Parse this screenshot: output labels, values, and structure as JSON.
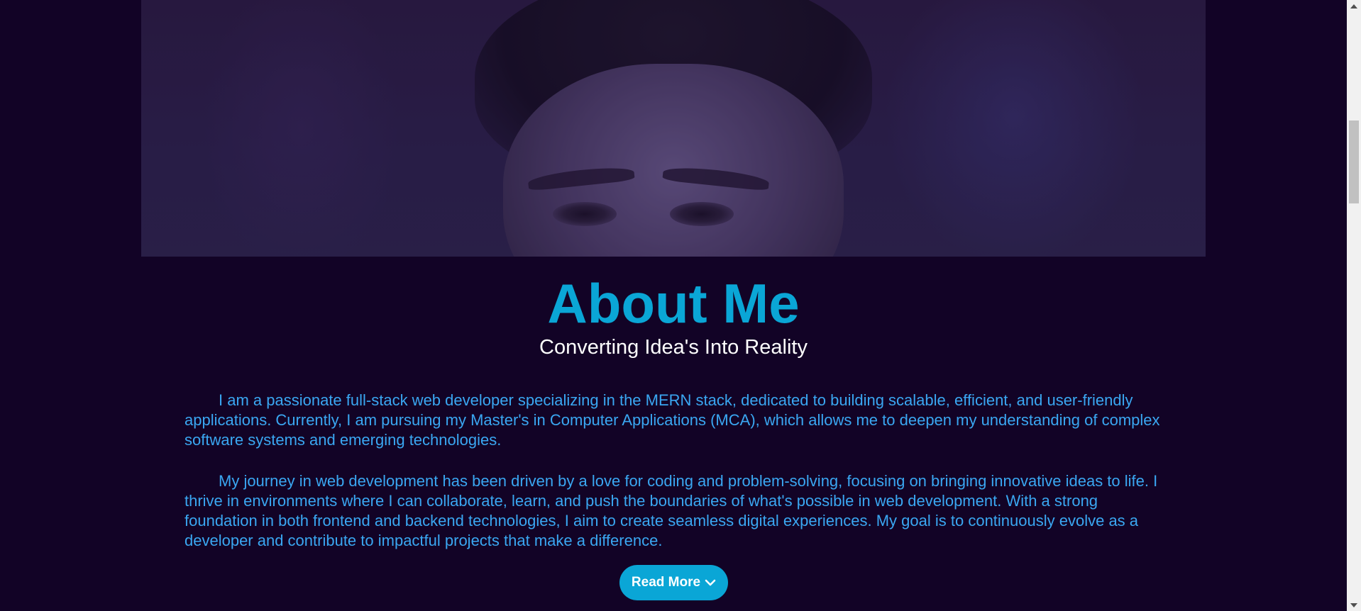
{
  "hero": {
    "image_alt": "Portrait photo"
  },
  "about": {
    "title": "About Me",
    "subtitle": "Converting Idea's Into Reality",
    "paragraphs": [
      "I am a passionate full-stack web developer specializing in the MERN stack, dedicated to building scalable, efficient, and user-friendly applications. Currently, I am pursuing my Master's in Computer Applications (MCA), which allows me to deepen my understanding of complex software systems and emerging technologies.",
      "My journey in web development has been driven by a love for coding and problem-solving, focusing on bringing innovative ideas to life. I thrive in environments where I can collaborate, learn, and push the boundaries of what's possible in web development. With a strong foundation in both frontend and backend technologies, I aim to create seamless digital experiences. My goal is to continuously evolve as a developer and contribute to impactful projects that make a difference."
    ],
    "read_more_label": "Read More",
    "read_more_icon": "chevron-down-icon"
  },
  "colors": {
    "background": "#120326",
    "accent": "#0aa6d6",
    "body_text": "#3aa7f2",
    "subtitle_text": "#ffffff"
  }
}
